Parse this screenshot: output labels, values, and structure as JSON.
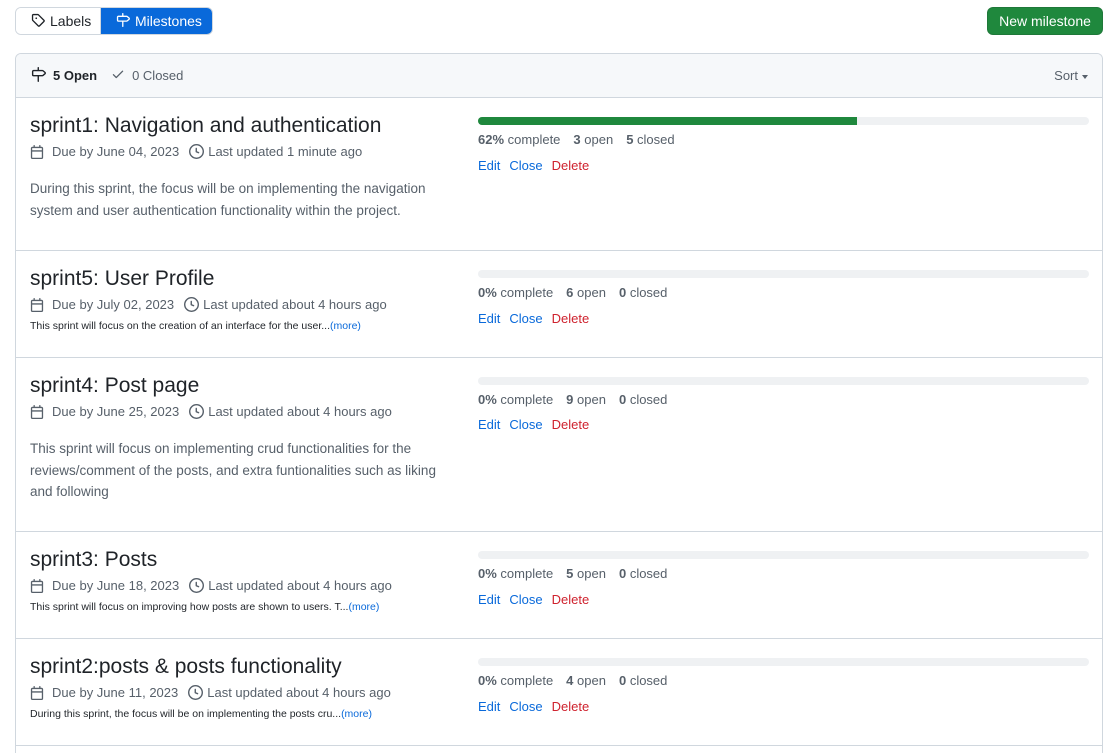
{
  "tabs": {
    "labels": "Labels",
    "milestones": "Milestones"
  },
  "new_milestone": "New milestone",
  "header": {
    "open_label": "5 Open",
    "closed_label": "0 Closed",
    "sort": "Sort"
  },
  "actions": {
    "edit": "Edit",
    "close": "Close",
    "delete": "Delete"
  },
  "colors": {
    "accent": "#0969da",
    "success": "#1f883d",
    "danger": "#cf222e"
  },
  "milestones": [
    {
      "title": "sprint1: Navigation and authentication",
      "due": "Due by June 04, 2023",
      "updated": "Last updated 1 minute ago",
      "description": "During this sprint, the focus will be on implementing the navigation system and user authentication functionality within the project.",
      "description_more": "",
      "progress": 0.62,
      "pct_label": "62%",
      "complete_word": "complete",
      "open_count": "3",
      "open_word": "open",
      "closed_count": "5",
      "closed_word": "closed"
    },
    {
      "title": "sprint5: User Profile",
      "due": "Due by July 02, 2023",
      "updated": "Last updated about 4 hours ago",
      "description": "This sprint will focus on the creation of an interface for the user...",
      "description_more": "(more)",
      "progress": 0,
      "pct_label": "0%",
      "complete_word": "complete",
      "open_count": "6",
      "open_word": "open",
      "closed_count": "0",
      "closed_word": "closed"
    },
    {
      "title": "sprint4: Post page",
      "due": "Due by June 25, 2023",
      "updated": "Last updated about 4 hours ago",
      "description": "This sprint will focus on implementing crud functionalities for the reviews/comment of the posts, and extra funtionalities such as liking and following",
      "description_more": "",
      "progress": 0,
      "pct_label": "0%",
      "complete_word": "complete",
      "open_count": "9",
      "open_word": "open",
      "closed_count": "0",
      "closed_word": "closed"
    },
    {
      "title": "sprint3: Posts",
      "due": "Due by June 18, 2023",
      "updated": "Last updated about 4 hours ago",
      "description": "This sprint will focus on improving how posts are shown to users. T...",
      "description_more": "(more)",
      "progress": 0,
      "pct_label": "0%",
      "complete_word": "complete",
      "open_count": "5",
      "open_word": "open",
      "closed_count": "0",
      "closed_word": "closed"
    },
    {
      "title": "sprint2:posts & posts functionality",
      "due": "Due by June 11, 2023",
      "updated": "Last updated about 4 hours ago",
      "description": "During this sprint, the focus will be on implementing the posts cru...",
      "description_more": "(more)",
      "progress": 0,
      "pct_label": "0%",
      "complete_word": "complete",
      "open_count": "4",
      "open_word": "open",
      "closed_count": "0",
      "closed_word": "closed"
    }
  ]
}
